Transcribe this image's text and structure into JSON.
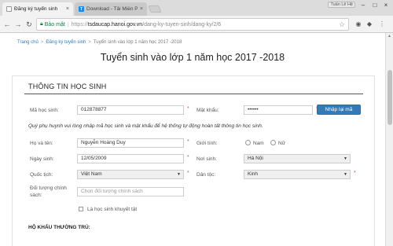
{
  "browser": {
    "tabs": [
      {
        "label": "Đăng ký tuyển sinh",
        "icon": "document-icon",
        "active": true
      },
      {
        "label": "Download - Tải Miễn Ph",
        "icon": "taimienphi-favicon",
        "active": false
      }
    ],
    "window_badge": "Tuấn Lê Hệ",
    "address": {
      "secure_label": "Bảo mật",
      "scheme": "https://",
      "host": "tsdaucap.hanoi.gov.vn",
      "path": "/dang-ky-tuyen-sinh/dang-ky/2/6"
    }
  },
  "breadcrumb": {
    "items": [
      "Trang chủ",
      "Đăng ký tuyển sinh",
      "Tuyển sinh vào lớp 1 năm học 2017 -2018"
    ],
    "separator": ">"
  },
  "page_title": "Tuyển sinh vào lớp 1 năm học 2017 -2018",
  "section": {
    "title": "THÔNG TIN HỌC SINH",
    "fields": {
      "student_code": {
        "label": "Mã học sinh:",
        "value": "012878877"
      },
      "password": {
        "label": "Mật khẩu:",
        "value": "••••••"
      },
      "reenter_button": "Nhập lại mã",
      "note": "Quý phụ huynh vui lòng nhập mã học sinh và mật khẩu để hệ thống tự động hoàn tất thông tin học sinh.",
      "full_name": {
        "label": "Họ và tên:",
        "value": "Nguyễn Hoàng Duy"
      },
      "gender": {
        "label": "Giới tính:",
        "options": [
          "Nam",
          "Nữ"
        ]
      },
      "dob": {
        "label": "Ngày sinh:",
        "value": "12/05/2009"
      },
      "birthplace": {
        "label": "Nơi sinh:",
        "value": "Hà Nội"
      },
      "nationality": {
        "label": "Quốc tịch:",
        "value": "Việt Nam"
      },
      "ethnicity": {
        "label": "Dân tộc:",
        "value": "Kinh"
      },
      "policy": {
        "label_line1": "Đối tượng chính",
        "label_line2": "sách:",
        "placeholder": "Chọn đối tượng chính sách"
      },
      "disabled_checkbox": "Là học sinh khuyết tật"
    },
    "household_title": "HỘ KHẨU THƯỜNG TRÚ:"
  },
  "colors": {
    "primary_button": "#337ab7",
    "required_star": "#d9534f",
    "link": "#337ab7"
  }
}
